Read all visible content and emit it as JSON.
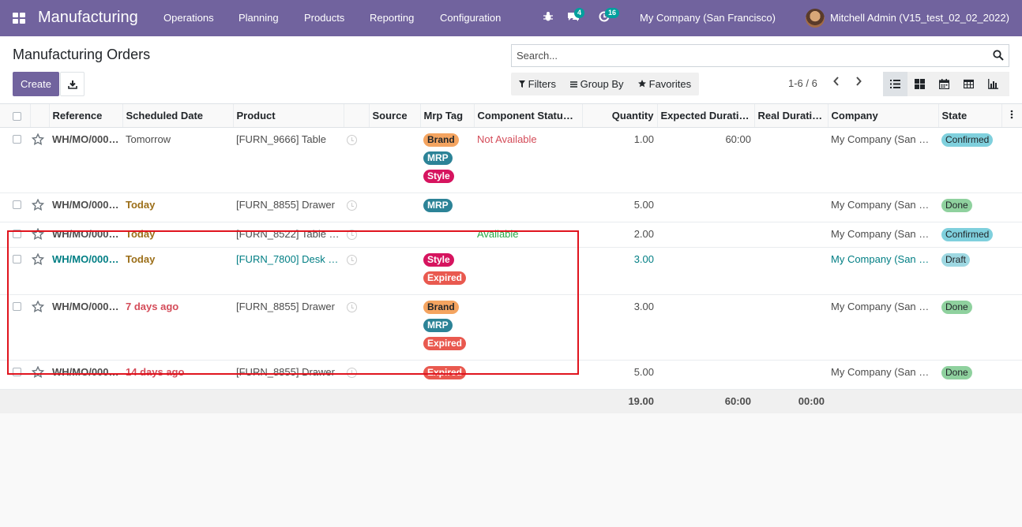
{
  "navbar": {
    "brand": "Manufacturing",
    "menus": [
      "Operations",
      "Planning",
      "Products",
      "Reporting",
      "Configuration"
    ],
    "messages_count": "4",
    "activities_count": "16",
    "company": "My Company (San Francisco)",
    "user": "Mitchell Admin (V15_test_02_02_2022)"
  },
  "control": {
    "title": "Manufacturing Orders",
    "create_label": "Create",
    "search_placeholder": "Search...",
    "filters_label": "Filters",
    "groupby_label": "Group By",
    "favorites_label": "Favorites",
    "pager": "1-6 / 6"
  },
  "columns": [
    "Reference",
    "Scheduled Date",
    "Product",
    "Source",
    "Mrp Tag",
    "Component Status…",
    "Quantity",
    "Expected Durati…",
    "Real Duration",
    "Company",
    "State"
  ],
  "tag_colors": {
    "Brand": {
      "bg": "#f4a460",
      "fg": "#212529"
    },
    "MRP": {
      "bg": "#2c8397",
      "fg": "#ffffff"
    },
    "Style": {
      "bg": "#d6145f",
      "fg": "#ffffff"
    },
    "Expired": {
      "bg": "#e9594f",
      "fg": "#ffffff"
    }
  },
  "state_colors": {
    "Confirmed": "#7fd0dd",
    "Done": "#8fd19e",
    "Draft": "#9ed8e2"
  },
  "rows": [
    {
      "reference": "WH/MO/000…",
      "date": "Tomorrow",
      "date_style": "normal",
      "product": "[FURN_9666] Table",
      "tags": [
        "Brand",
        "MRP",
        "Style"
      ],
      "component_status": "Not Available",
      "component_style": "danger",
      "quantity": "1.00",
      "expected": "60:00",
      "real": "",
      "company": "My Company (San F…",
      "state": "Confirmed",
      "draft": false
    },
    {
      "reference": "WH/MO/000…",
      "date": "Today",
      "date_style": "warning",
      "product": "[FURN_8855] Drawer",
      "tags": [
        "MRP"
      ],
      "component_status": "",
      "component_style": "normal",
      "quantity": "5.00",
      "expected": "",
      "real": "",
      "company": "My Company (San F…",
      "state": "Done",
      "draft": false
    },
    {
      "reference": "WH/MO/000…",
      "date": "Today",
      "date_style": "warning",
      "product": "[FURN_8522] Table …",
      "tags": [],
      "component_status": "Available",
      "component_style": "success",
      "quantity": "2.00",
      "expected": "",
      "real": "",
      "company": "My Company (San F…",
      "state": "Confirmed",
      "draft": false
    },
    {
      "reference": "WH/MO/000…",
      "date": "Today",
      "date_style": "warning",
      "product": "[FURN_7800] Desk …",
      "tags": [
        "Style",
        "Expired"
      ],
      "component_status": "",
      "component_style": "normal",
      "quantity": "3.00",
      "expected": "",
      "real": "",
      "company": "My Company (San F…",
      "state": "Draft",
      "draft": true
    },
    {
      "reference": "WH/MO/000…",
      "date": "7 days ago",
      "date_style": "danger",
      "product": "[FURN_8855] Drawer",
      "tags": [
        "Brand",
        "MRP",
        "Expired"
      ],
      "component_status": "",
      "component_style": "normal",
      "quantity": "3.00",
      "expected": "",
      "real": "",
      "company": "My Company (San F…",
      "state": "Done",
      "draft": false
    },
    {
      "reference": "WH/MO/000…",
      "date": "14 days ago",
      "date_style": "danger",
      "product": "[FURN_8855] Drawer",
      "tags": [
        "Expired"
      ],
      "component_status": "",
      "component_style": "normal",
      "quantity": "5.00",
      "expected": "",
      "real": "",
      "company": "My Company (San F…",
      "state": "Done",
      "draft": false
    }
  ],
  "totals": {
    "quantity": "19.00",
    "expected": "60:00",
    "real": "00:00"
  }
}
